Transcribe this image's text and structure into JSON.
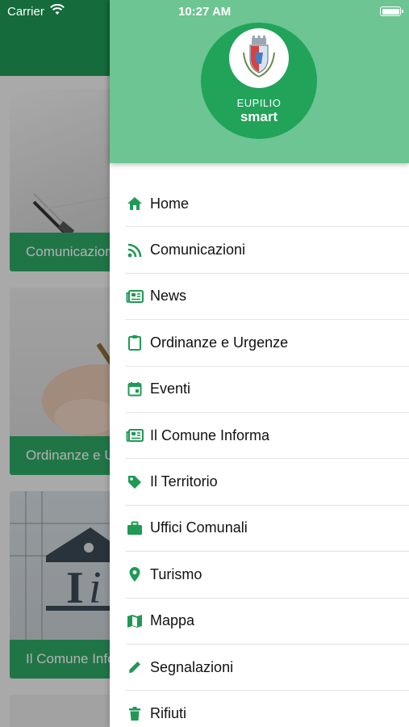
{
  "status_bar": {
    "carrier": "Carrier",
    "time": "10:27 AM"
  },
  "background_cards": [
    {
      "caption": "Comunicazioni"
    },
    {
      "caption": "Ordinanze e Urgenze"
    },
    {
      "caption": "Il Comune Informa"
    }
  ],
  "drawer": {
    "logo": {
      "name": "EUPILIO",
      "sub": "smart"
    },
    "accent_color": "#1f9a55",
    "menu_items": [
      {
        "label": "Home",
        "icon": "home-icon"
      },
      {
        "label": "Comunicazioni",
        "icon": "rss-icon"
      },
      {
        "label": "News",
        "icon": "newspaper-icon"
      },
      {
        "label": "Ordinanze e Urgenze",
        "icon": "clipboard-icon"
      },
      {
        "label": "Eventi",
        "icon": "calendar-icon"
      },
      {
        "label": "Il Comune Informa",
        "icon": "newspaper-icon"
      },
      {
        "label": "Il Territorio",
        "icon": "tag-icon"
      },
      {
        "label": "Uffici Comunali",
        "icon": "briefcase-icon"
      },
      {
        "label": "Turismo",
        "icon": "map-pin-icon"
      },
      {
        "label": "Mappa",
        "icon": "map-icon"
      },
      {
        "label": "Segnalazioni",
        "icon": "pencil-icon"
      },
      {
        "label": "Rifiuti",
        "icon": "trash-icon"
      }
    ]
  }
}
